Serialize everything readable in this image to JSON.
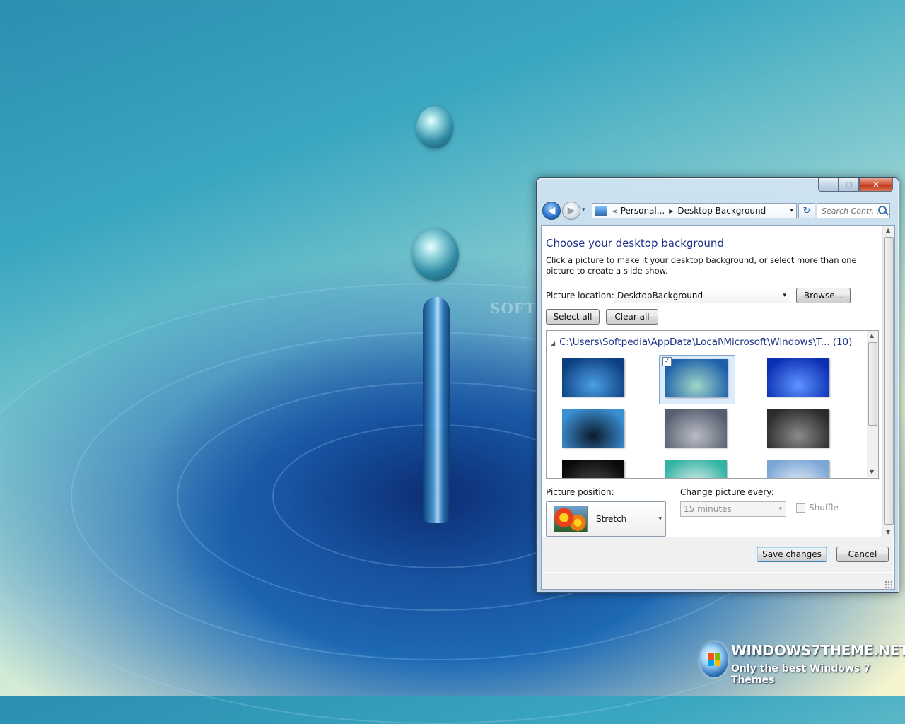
{
  "desktop": {
    "watermark": "SOFTPEDIA",
    "brand_title": "WINDOWS7THEME.NET",
    "brand_subtitle": "Only the best Windows 7 Themes"
  },
  "window": {
    "caption_buttons": {
      "minimize": "–",
      "maximize": "□",
      "close": "✕"
    },
    "nav": {
      "back": "◀",
      "forward": "▶",
      "recent": "▾"
    },
    "address": {
      "chevron": "«",
      "crumbs": [
        "Personal...",
        "Desktop Background"
      ],
      "separator": "▶",
      "dropdown": "▾"
    },
    "refresh": "↻",
    "search": {
      "placeholder": "Search Contr..."
    }
  },
  "content": {
    "heading": "Choose your desktop background",
    "description": "Click a picture to make it your desktop background, or select more than one picture to create a slide show.",
    "picture_location": {
      "label": "Picture location:",
      "value": "DesktopBackground",
      "browse": "Browse..."
    },
    "select_all": "Select all",
    "clear_all": "Clear all",
    "gallery": {
      "toggle": "◢",
      "path": "C:\\Users\\Softpedia\\AppData\\Local\\Microsoft\\Windows\\T...",
      "count": "(10)",
      "checkmark": "✓",
      "thumbnails": [
        {
          "name": "ripple-crown",
          "selected": false,
          "colors": [
            "#4a9fe3",
            "#0d3f80"
          ]
        },
        {
          "name": "water-drop",
          "selected": true,
          "colors": [
            "#9fd6c8",
            "#1d5fa9"
          ]
        },
        {
          "name": "splash-blue",
          "selected": false,
          "colors": [
            "#5f93ff",
            "#0b2fb3"
          ]
        },
        {
          "name": "dark-splash",
          "selected": false,
          "colors": [
            "#0b1a2c",
            "#3b8fd3"
          ]
        },
        {
          "name": "grey-ripple",
          "selected": false,
          "colors": [
            "#b9bdc7",
            "#595e6e"
          ]
        },
        {
          "name": "rain-drops",
          "selected": false,
          "colors": [
            "#8b8b8b",
            "#2b2b2b"
          ]
        },
        {
          "name": "night-drop",
          "selected": false,
          "colors": [
            "#4a4a4a",
            "#0a0a0a"
          ]
        },
        {
          "name": "teal-splash",
          "selected": false,
          "colors": [
            "#e8f4f1",
            "#34b3a4"
          ]
        },
        {
          "name": "pale-drops",
          "selected": false,
          "colors": [
            "#e9f0f8",
            "#7ba6d6"
          ]
        }
      ]
    },
    "picture_position": {
      "label": "Picture position:",
      "value": "Stretch"
    },
    "change_picture": {
      "label": "Change picture every:",
      "value": "15 minutes"
    },
    "shuffle": "Shuffle",
    "save": "Save changes",
    "cancel": "Cancel",
    "caret": "▾"
  }
}
